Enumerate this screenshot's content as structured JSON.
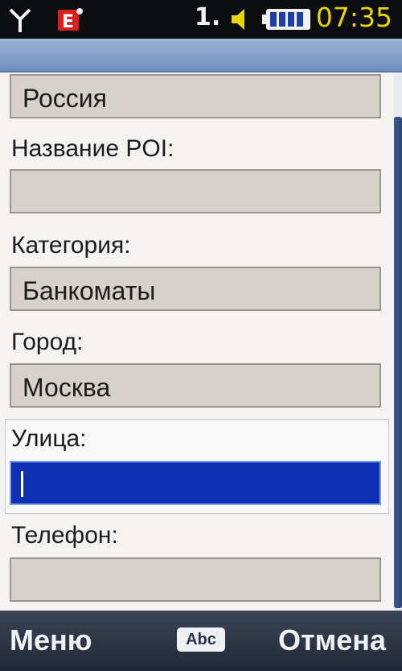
{
  "status_bar": {
    "line_indicator": "1.",
    "time": "07:35",
    "icons": [
      "signal-icon",
      "message-icon",
      "speaker-icon",
      "battery-icon"
    ]
  },
  "form": {
    "country_value": "Россия",
    "poi_name_label": "Название POI:",
    "poi_name_value": "",
    "category_label": "Категория:",
    "category_value": "Банкоматы",
    "city_label": "Город:",
    "city_value": "Москва",
    "street_label": "Улица:",
    "street_value": "",
    "phone_label": "Телефон:",
    "phone_value": ""
  },
  "softkeys": {
    "left_label": "Меню",
    "input_mode": "Abc",
    "right_label": "Отмена"
  },
  "colors": {
    "active_field": "#0d2fb4",
    "time": "#e8d400",
    "field_bg": "#d6d2cb"
  }
}
